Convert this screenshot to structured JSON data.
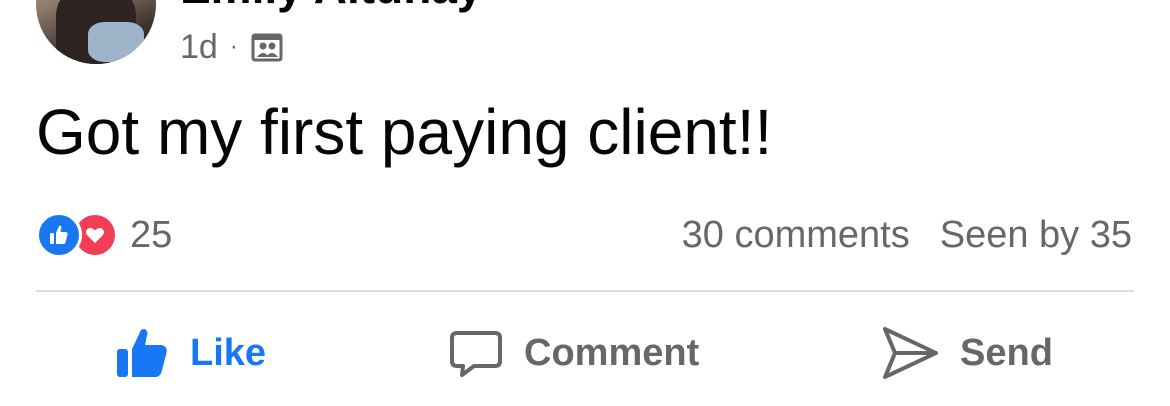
{
  "post": {
    "author": "Emily Altunay",
    "time": "1d",
    "separator": "·",
    "privacy_icon": "friends-icon",
    "text": "Got my first paying client!!"
  },
  "stats": {
    "reaction_icons": [
      "like-icon",
      "love-icon"
    ],
    "reaction_count": "25",
    "comments": "30 comments",
    "seen": "Seen by 35"
  },
  "actions": {
    "like": "Like",
    "comment": "Comment",
    "send": "Send"
  },
  "colors": {
    "like_blue": "#1877f2",
    "love_red": "#f33e58",
    "secondary_text": "#65676b",
    "divider": "#dadde1"
  }
}
